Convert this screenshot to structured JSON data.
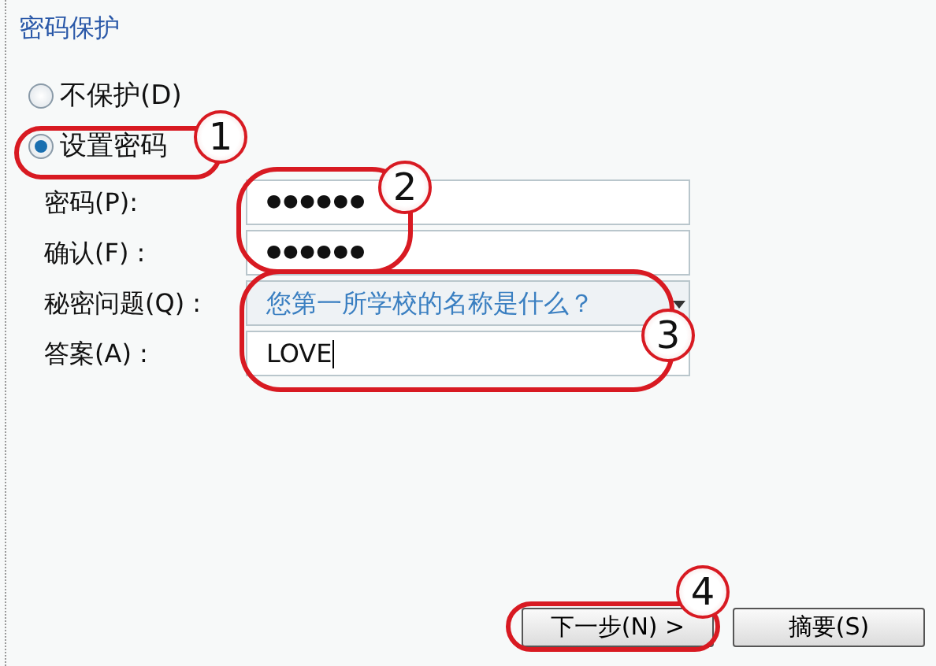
{
  "title": "密码保护",
  "options": [
    {
      "label": "不保护(D)",
      "selected": false
    },
    {
      "label": "设置密码",
      "selected": true
    }
  ],
  "fields": [
    {
      "kind": "password",
      "label": "密码(P):",
      "value": "●●●●●●"
    },
    {
      "kind": "password",
      "label": "确认(F) :",
      "value": "●●●●●●"
    },
    {
      "kind": "combo",
      "label": "秘密问题(Q) :",
      "value": "您第一所学校的名称是什么？"
    },
    {
      "kind": "text",
      "label": "答案(A) :",
      "value": "LOVE"
    }
  ],
  "buttons": [
    {
      "label": "下一步(N) >"
    },
    {
      "label": "摘要(S)"
    }
  ],
  "callouts": [
    {
      "number": "1"
    },
    {
      "number": "2"
    },
    {
      "number": "3"
    },
    {
      "number": "4"
    }
  ]
}
